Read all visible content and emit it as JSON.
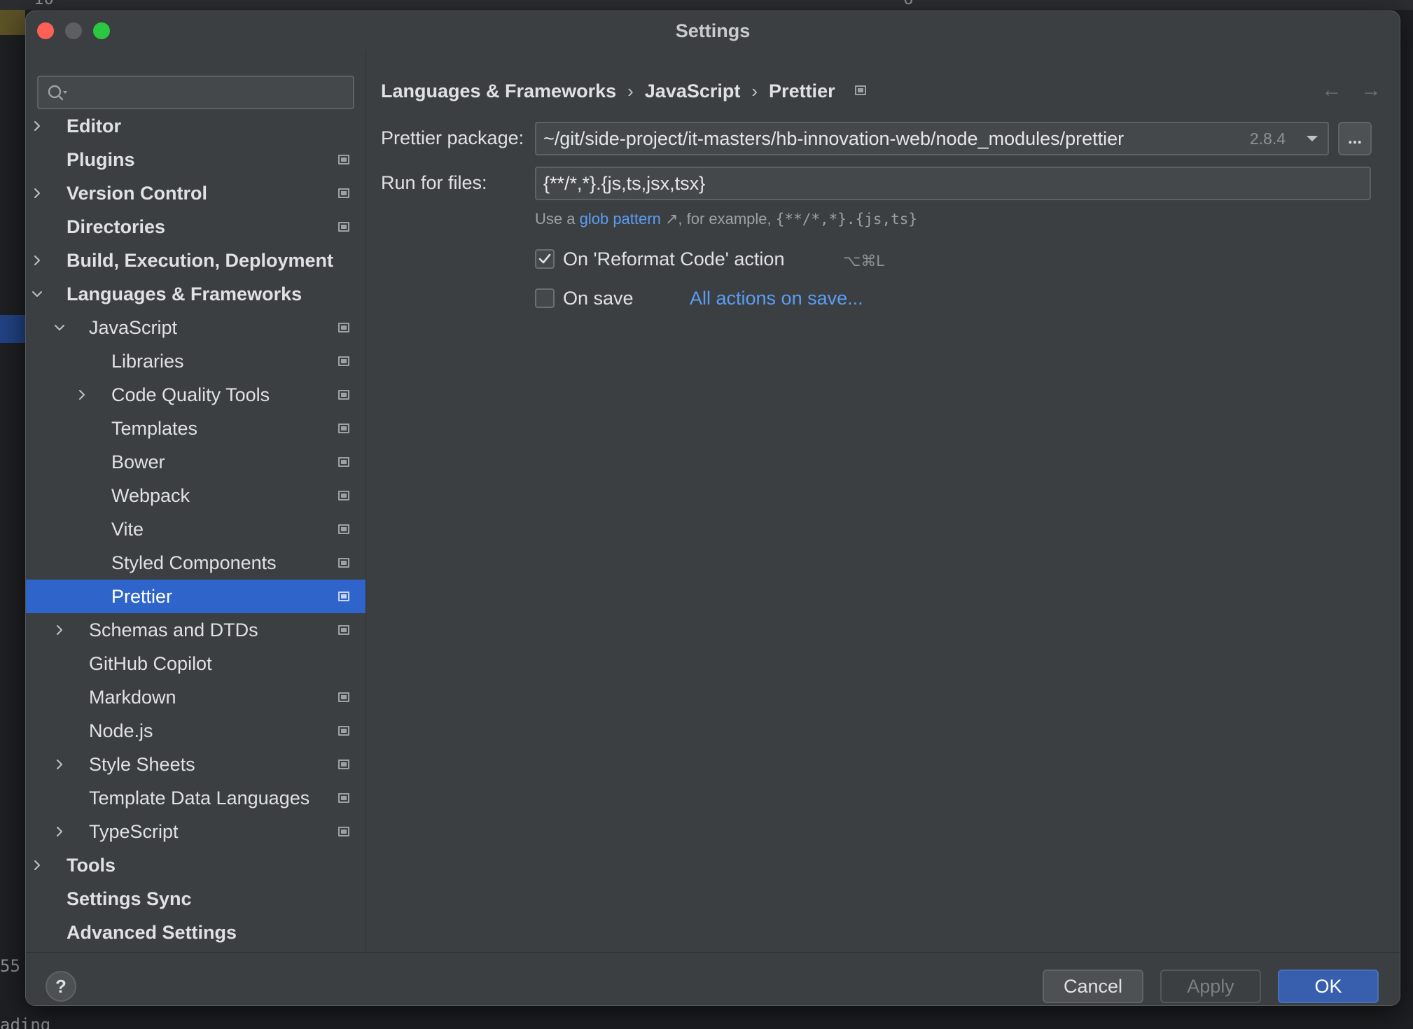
{
  "window": {
    "title": "Settings"
  },
  "background": {
    "gutter_top": "10",
    "gutter_55": "55",
    "gutter_bottom": "ading",
    "tab_fragment": "6"
  },
  "sidebar": {
    "search_placeholder": "",
    "items": [
      {
        "label": "Editor",
        "level": 0,
        "bold": true,
        "expander": "collapsed",
        "badge": false
      },
      {
        "label": "Plugins",
        "level": 0,
        "bold": true,
        "expander": "none",
        "badge": true
      },
      {
        "label": "Version Control",
        "level": 0,
        "bold": true,
        "expander": "collapsed",
        "badge": true
      },
      {
        "label": "Directories",
        "level": 0,
        "bold": true,
        "expander": "none",
        "badge": true
      },
      {
        "label": "Build, Execution, Deployment",
        "level": 0,
        "bold": true,
        "expander": "collapsed",
        "badge": false
      },
      {
        "label": "Languages & Frameworks",
        "level": 0,
        "bold": true,
        "expander": "expanded",
        "badge": false
      },
      {
        "label": "JavaScript",
        "level": 1,
        "bold": false,
        "expander": "expanded",
        "badge": true
      },
      {
        "label": "Libraries",
        "level": 2,
        "bold": false,
        "expander": "none",
        "badge": true
      },
      {
        "label": "Code Quality Tools",
        "level": 2,
        "bold": false,
        "expander": "collapsed",
        "badge": true
      },
      {
        "label": "Templates",
        "level": 2,
        "bold": false,
        "expander": "none",
        "badge": true
      },
      {
        "label": "Bower",
        "level": 2,
        "bold": false,
        "expander": "none",
        "badge": true
      },
      {
        "label": "Webpack",
        "level": 2,
        "bold": false,
        "expander": "none",
        "badge": true
      },
      {
        "label": "Vite",
        "level": 2,
        "bold": false,
        "expander": "none",
        "badge": true
      },
      {
        "label": "Styled Components",
        "level": 2,
        "bold": false,
        "expander": "none",
        "badge": true
      },
      {
        "label": "Prettier",
        "level": 2,
        "bold": false,
        "expander": "none",
        "badge": true,
        "selected": true
      },
      {
        "label": "Schemas and DTDs",
        "level": 1,
        "bold": false,
        "expander": "collapsed",
        "badge": true
      },
      {
        "label": "GitHub Copilot",
        "level": 1,
        "bold": false,
        "expander": "none",
        "badge": false
      },
      {
        "label": "Markdown",
        "level": 1,
        "bold": false,
        "expander": "none",
        "badge": true
      },
      {
        "label": "Node.js",
        "level": 1,
        "bold": false,
        "expander": "none",
        "badge": true
      },
      {
        "label": "Style Sheets",
        "level": 1,
        "bold": false,
        "expander": "collapsed",
        "badge": true
      },
      {
        "label": "Template Data Languages",
        "level": 1,
        "bold": false,
        "expander": "none",
        "badge": true
      },
      {
        "label": "TypeScript",
        "level": 1,
        "bold": false,
        "expander": "collapsed",
        "badge": true
      },
      {
        "label": "Tools",
        "level": 0,
        "bold": true,
        "expander": "collapsed",
        "badge": false
      },
      {
        "label": "Settings Sync",
        "level": 0,
        "bold": true,
        "expander": "none",
        "badge": false
      },
      {
        "label": "Advanced Settings",
        "level": 0,
        "bold": true,
        "expander": "none",
        "badge": false
      }
    ]
  },
  "main": {
    "breadcrumb": [
      "Languages & Frameworks",
      "JavaScript",
      "Prettier"
    ],
    "breadcrumb_sep": "›",
    "nav_back": "←",
    "nav_forward": "→",
    "package_label": "Prettier package:",
    "package_value": "~/git/side-project/it-masters/hb-innovation-web/node_modules/prettier",
    "package_version": "2.8.4",
    "browse_label": "...",
    "run_label": "Run for files:",
    "run_value": "{**/*,*}.{js,ts,jsx,tsx}",
    "hint_prefix": "Use a",
    "hint_link": "glob pattern",
    "hint_link_arrow": "↗",
    "hint_middle": ", for example,",
    "hint_example": "{**/*,*}.{js,ts}",
    "reformat_label": "On 'Reformat Code' action",
    "reformat_checked": true,
    "reformat_shortcut": "⌥⌘L",
    "on_save_label": "On save",
    "on_save_checked": false,
    "all_actions_link": "All actions on save..."
  },
  "footer": {
    "help": "?",
    "cancel": "Cancel",
    "apply": "Apply",
    "ok": "OK"
  },
  "colors": {
    "selection": "#2f65ca",
    "link": "#5a9df5",
    "ok_button": "#375fad"
  }
}
